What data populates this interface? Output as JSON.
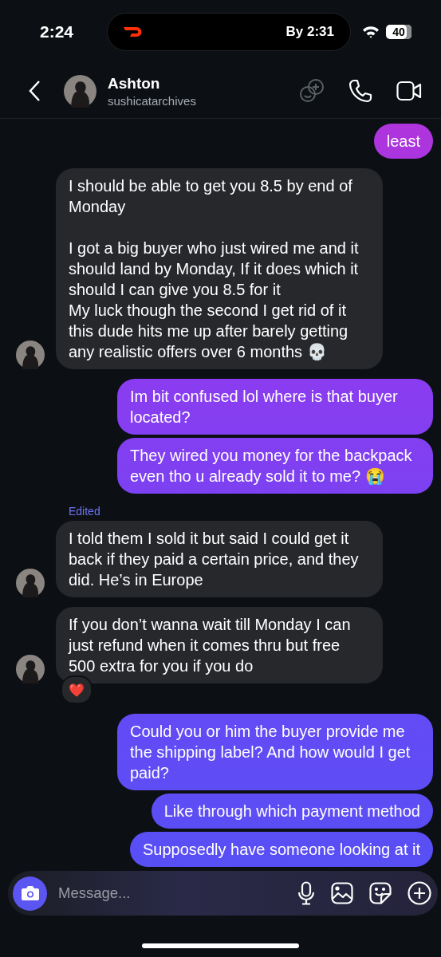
{
  "status_bar": {
    "time": "2:24",
    "live_activity": "By 2:31",
    "battery": "40"
  },
  "header": {
    "name": "Ashton",
    "username": "sushicatarchives"
  },
  "messages": [
    {
      "kind": "sent",
      "text": "least"
    },
    {
      "kind": "received",
      "text": "I should be able to get you 8.5 by end of Monday\n\nI got a big buyer who just wired me and it should land by Monday, If it does which it should I can give you 8.5 for it\nMy luck though the second I get rid of it this dude hits me up after barely getting any realistic offers over 6 months 💀",
      "avatar": true
    },
    {
      "kind": "sent",
      "text": "Im bit confused lol where is that buyer located?"
    },
    {
      "kind": "sent",
      "text": "They wired you money for the backpack even tho u already sold it to me? 😭"
    },
    {
      "kind": "received",
      "label": "Edited",
      "text": "I told them I sold it but said I could get it back if they paid a certain price, and they did. He’s in Europe",
      "avatar": true
    },
    {
      "kind": "received",
      "text": "If you don’t wanna wait till Monday I can just refund when it comes thru but free 500 extra for you if you do",
      "avatar": true,
      "reaction": "❤️"
    },
    {
      "kind": "sent",
      "text": "Could you or him the buyer provide me the shipping label? And how would I get paid?"
    },
    {
      "kind": "sent",
      "text": "Like through which payment method"
    },
    {
      "kind": "sent",
      "text": "Supposedly have someone looking at it"
    }
  ],
  "composer": {
    "placeholder": "Message..."
  }
}
